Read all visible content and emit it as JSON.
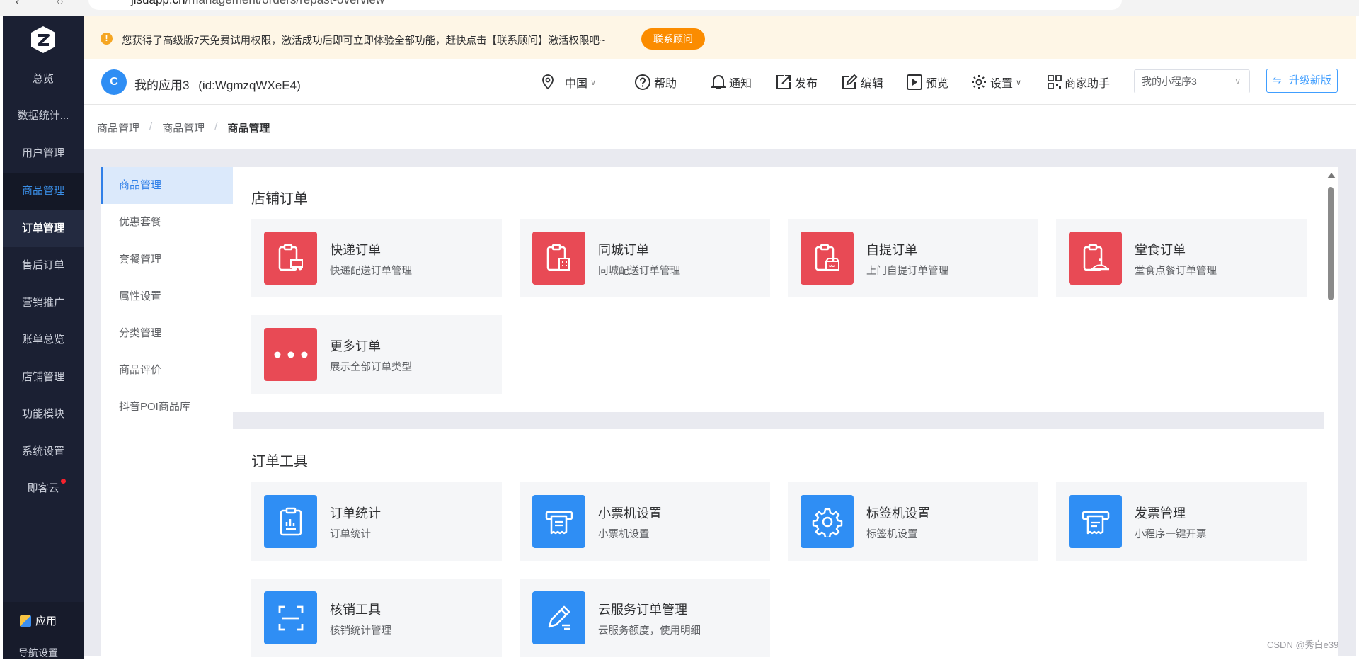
{
  "browser": {
    "host": "jisuapp.cn",
    "path": "/management/orders/repast-overview"
  },
  "leftnav": {
    "items": [
      {
        "label": "总览"
      },
      {
        "label": "数据统计..."
      },
      {
        "label": "用户管理"
      },
      {
        "label": "商品管理"
      },
      {
        "label": "订单管理"
      },
      {
        "label": "售后订单"
      },
      {
        "label": "营销推广"
      },
      {
        "label": "账单总览"
      },
      {
        "label": "店铺管理"
      },
      {
        "label": "功能模块"
      },
      {
        "label": "系统设置"
      },
      {
        "label": "即客云"
      }
    ],
    "bottom": {
      "apps_label": "应用",
      "more_label": "导航设置"
    }
  },
  "notice": {
    "text": "您获得了高级版7天免费试用权限，激活成功后即可立即体验全部功能，赶快点击【联系顾问】激活权限吧~",
    "button": "联系顾问"
  },
  "header": {
    "app_name": "我的应用3",
    "app_id": "(id:WgmzqWXeE4)",
    "region": "中国",
    "help": "帮助",
    "notify": "通知",
    "publish": "发布",
    "edit": "编辑",
    "preview": "预览",
    "settings": "设置",
    "merchant": "商家助手",
    "select_value": "我的小程序3",
    "upgrade": "升级新版"
  },
  "breadcrumb": [
    "商品管理",
    "商品管理",
    "商品管理"
  ],
  "submenu": {
    "items": [
      {
        "label": "商品管理"
      },
      {
        "label": "优惠套餐"
      },
      {
        "label": "套餐管理"
      },
      {
        "label": "属性设置"
      },
      {
        "label": "分类管理"
      },
      {
        "label": "商品评价"
      },
      {
        "label": "抖音POI商品库"
      }
    ]
  },
  "sections": {
    "store_orders": {
      "title": "店铺订单",
      "cards": [
        {
          "title": "快递订单",
          "desc": "快递配送订单管理",
          "icon": "delivery-truck-icon"
        },
        {
          "title": "同城订单",
          "desc": "同城配送订单管理",
          "icon": "city-building-icon"
        },
        {
          "title": "自提订单",
          "desc": "上门自提订单管理",
          "icon": "store-pickup-icon"
        },
        {
          "title": "堂食订单",
          "desc": "堂食点餐订单管理",
          "icon": "dining-cloche-icon"
        },
        {
          "title": "更多订单",
          "desc": "展示全部订单类型",
          "icon": "more-dots-icon"
        }
      ]
    },
    "order_tools": {
      "title": "订单工具",
      "cards": [
        {
          "title": "订单统计",
          "desc": "订单统计",
          "icon": "stats-clipboard-icon"
        },
        {
          "title": "小票机设置",
          "desc": "小票机设置",
          "icon": "receipt-printer-icon"
        },
        {
          "title": "标签机设置",
          "desc": "标签机设置",
          "icon": "gear-icon"
        },
        {
          "title": "发票管理",
          "desc": "小程序一键开票",
          "icon": "invoice-icon"
        },
        {
          "title": "核销工具",
          "desc": "核销统计管理",
          "icon": "scan-icon"
        },
        {
          "title": "云服务订单管理",
          "desc": "云服务额度，使用明细",
          "icon": "pen-edit-icon"
        }
      ]
    }
  },
  "watermark": "CSDN @秀白e39",
  "colors": {
    "red": "#e84a55",
    "blue": "#2f8ef4",
    "nav_bg": "#1b2033",
    "accent": "#409eff",
    "orange": "#fb8c00"
  }
}
